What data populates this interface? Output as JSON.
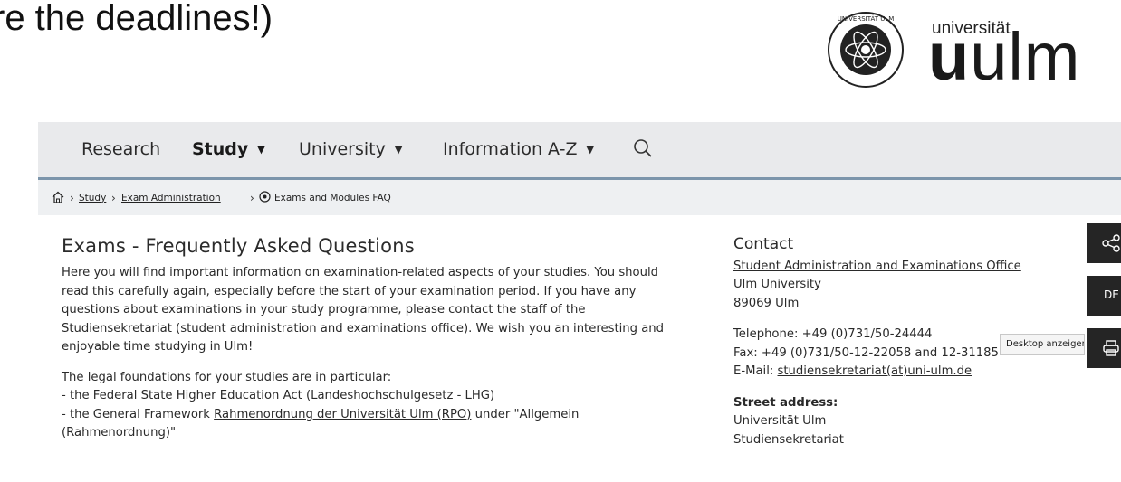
{
  "slide_text": "re the deadlines!)",
  "logo": {
    "small": "universität",
    "big_bold": "u",
    "big_regular": "ulm"
  },
  "nav": {
    "items": [
      {
        "label": "Research",
        "caret": false,
        "active": false
      },
      {
        "label": "Study",
        "caret": true,
        "active": true
      },
      {
        "label": "University",
        "caret": true,
        "active": false
      },
      {
        "label": "Information A-Z",
        "caret": true,
        "active": false
      }
    ],
    "search_icon": "search-icon"
  },
  "breadcrumb": {
    "home_icon": "home-icon",
    "study": "Study",
    "exam_admin": "Exam Administration",
    "current": "Exams and Modules FAQ",
    "location_icon": "location-pin-icon"
  },
  "main": {
    "title": "Exams - Frequently Asked Questions",
    "intro": [
      "Here you will find important information on examination-related aspects of your studies. You should",
      "read this carefully again, especially before the start of your examination period. If you have any",
      "questions about examinations in your study programme, please contact the staff of the",
      "Studiensekretariat (student administration and examinations office). We wish you an interesting and",
      "enjoyable time studying in Ulm!"
    ],
    "legal_intro": "The legal foundations for your studies are in particular:",
    "legal_item1": "- the Federal State Higher Education Act (Landeshochschulgesetz - LHG)",
    "legal_item2_prefix": "- the General Framework ",
    "legal_item2_link": "Rahmenordnung der Universität Ulm (RPO)",
    "legal_item2_suffix": " under \"Allgemein",
    "legal_item2_cont": "(Rahmenordnung)\""
  },
  "contact": {
    "title": "Contact",
    "office_link": "Student Administration and Examinations Office",
    "university": "Ulm University",
    "city": "89069 Ulm",
    "telephone": "Telephone: +49 (0)731/50-24444",
    "fax": "Fax: +49 (0)731/50-12-22058 and 12-31185",
    "email_label": "E-Mail: ",
    "email": "studiensekretariat(at)uni-ulm.de",
    "street_title": "Street address:",
    "street1": "Universität Ulm",
    "street2": "Studiensekretariat"
  },
  "side_tools": {
    "share_icon": "share-icon",
    "lang": "DE",
    "print_icon": "print-icon"
  },
  "tooltip": "Desktop anzeigen"
}
